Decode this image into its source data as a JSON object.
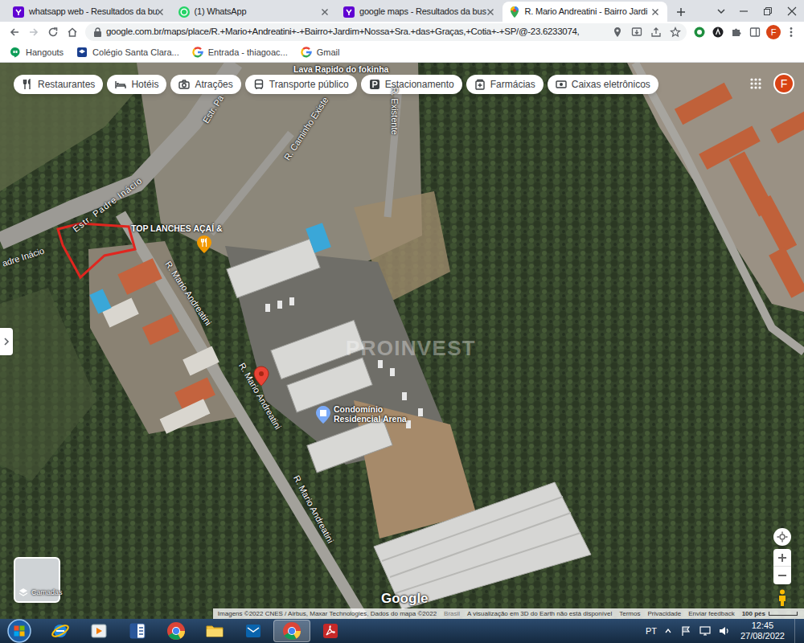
{
  "browser": {
    "tabs": [
      {
        "label": "whatsapp web - Resultados da bu",
        "kind": "yahoo",
        "selected": false
      },
      {
        "label": "(1) WhatsApp",
        "kind": "whatsapp",
        "selected": false
      },
      {
        "label": "google maps - Resultados da bus",
        "kind": "yahoo",
        "selected": false
      },
      {
        "label": "R. Mario Andreatini - Bairro Jardi",
        "kind": "maps",
        "selected": true
      }
    ],
    "address": "google.com.br/maps/place/R.+Mario+Andreatini+-+Bairro+Jardim+Nossa+Sra.+das+Graças,+Cotia+-+SP/@-23.6233074,",
    "profile": "F",
    "bookmarks": [
      {
        "label": "Hangouts",
        "kind": "hangouts"
      },
      {
        "label": "Colégio Santa Clara...",
        "kind": "school"
      },
      {
        "label": "Entrada - thiagoac...",
        "kind": "google"
      },
      {
        "label": "Gmail",
        "kind": "google"
      }
    ]
  },
  "map": {
    "chips": [
      {
        "label": "Restaurantes",
        "kind": "restaurant"
      },
      {
        "label": "Hotéis",
        "kind": "hotel"
      },
      {
        "label": "Atrações",
        "kind": "attraction"
      },
      {
        "label": "Transporte público",
        "kind": "transit"
      },
      {
        "label": "Estacionamento",
        "kind": "parking"
      },
      {
        "label": "Farmácias",
        "kind": "pharmacy"
      },
      {
        "label": "Caixas eletrônicos",
        "kind": "atm"
      }
    ],
    "avatar": "F",
    "places": [
      {
        "label": "Lava Rapido do fokinha",
        "kind": "plain"
      },
      {
        "label": "TOP LANCHES AÇAÍ &",
        "kind": "food"
      },
      {
        "label": "Condomínio Residencial Arena",
        "kind": "condo"
      }
    ],
    "streets": [
      "Estr. Padre Inácio",
      "Estr. Pa",
      "R. Caminho Existe",
      "R. Existente",
      "adre Inácio",
      "R. Mario Andreatini",
      "R. Mario Andreatini",
      "R. Mario Andreatini"
    ],
    "watermark": "PROINVEST",
    "logo": "Google",
    "layers": "Camadas",
    "footer": [
      "Imagens ©2022 CNES / Airbus, Maxar Technologies, Dados do mapa ©2022",
      "Brasil",
      "A visualização em 3D do Earth não está disponível",
      "Termos",
      "Privacidade",
      "Enviar feedback"
    ],
    "scale": "100 pés"
  },
  "taskbar": {
    "apps": [
      {
        "kind": "ie",
        "selected": false
      },
      {
        "kind": "media",
        "selected": false
      },
      {
        "kind": "word",
        "selected": false
      },
      {
        "kind": "chrome",
        "selected": false
      },
      {
        "kind": "explorer",
        "selected": false
      },
      {
        "kind": "outlook",
        "selected": false
      },
      {
        "kind": "chrome",
        "selected": true
      },
      {
        "kind": "acrobat",
        "selected": false
      }
    ],
    "language": "PT",
    "time": "12:45",
    "date": "27/08/2022"
  }
}
